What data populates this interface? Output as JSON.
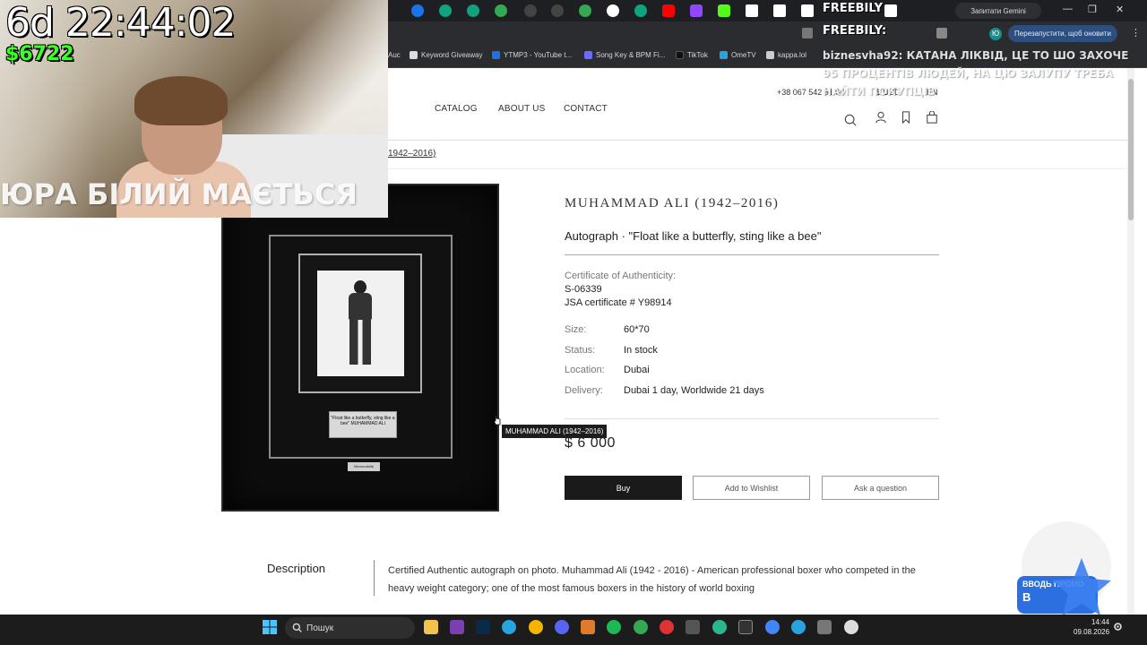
{
  "browser": {
    "bookmarks": [
      "Auc",
      "Keyword Giveaway",
      "YTMP3 - YouTube t...",
      "Song Key & BPM Fi...",
      "TikTok",
      "OmeTV",
      "kappa.lol"
    ],
    "gemini_label": "Запитати Gemini",
    "relaunch_label": "Перезапустити, щоб оновити",
    "profile_initial": "Ю"
  },
  "site": {
    "nav": [
      "CATALOG",
      "ABOUT US",
      "CONTACT"
    ],
    "phone": "+38 067 542 61 66",
    "currency": "$ USD",
    "language": "EN",
    "breadcrumb": "1942–2016)"
  },
  "product": {
    "title": "MUHAMMAD ALI (1942–2016)",
    "subtitle": "Autograph · \"Float like a butterfly, sting like a bee\"",
    "certificate_label": "Certificate of Authenticity:",
    "certificate_number": "S-06339",
    "certificate_jsa": "JSA certificate # Y98914",
    "specs": [
      {
        "key": "Size:",
        "value": "60*70"
      },
      {
        "key": "Status:",
        "value": "In stock"
      },
      {
        "key": "Location:",
        "value": "Dubai"
      },
      {
        "key": "Delivery:",
        "value": "Dubai 1 day, Worldwide 21 days"
      }
    ],
    "price": "$ 6 000",
    "buttons": {
      "buy": "Buy",
      "wishlist": "Add to Wishlist",
      "ask": "Ask a question"
    },
    "tooltip": "MUHAMMAD ALI (1942–2016)",
    "plaque_text": "\"Float like a butterfly, sting like a bee\" MUHAMMAD ALI",
    "memorabilia_tag": "Memorabilia"
  },
  "description": {
    "label": "Description",
    "text": "Certified Authentic autograph on photo. Muhammad Ali (1942 - 2016) - American professional boxer who competed in the heavy weight category; one of the most famous boxers in the history of world boxing"
  },
  "overlay": {
    "timer": "6d 22:44:02",
    "money": "$6722",
    "caption": "ЮРА БІЛИЙ МАЄТЬСЯ",
    "freebily": "FREEBILY",
    "freebily2": "FREEBILY:",
    "chat_message": "biznesvha92: КАТАНА ЛІКВІД, ЦЕ ТО ШО ЗАХОЧЕ 95 ПРОЦЕНТІВ ЛЮДЕЙ, НА ЦЮ ЗАЛУПУ ТРЕБА НАЙТИ ПОКУПЦІВ"
  },
  "widgets": {
    "promo_text": "ВВОДЬ ПРОМО",
    "promo_sub": "В"
  },
  "taskbar": {
    "search_placeholder": "Пошук",
    "time": "14:44",
    "date": "09.08.2026"
  },
  "colors": {
    "buy_button": "#1a1a1a",
    "money": "#3cff2a",
    "promo": "#2c6fe0"
  }
}
